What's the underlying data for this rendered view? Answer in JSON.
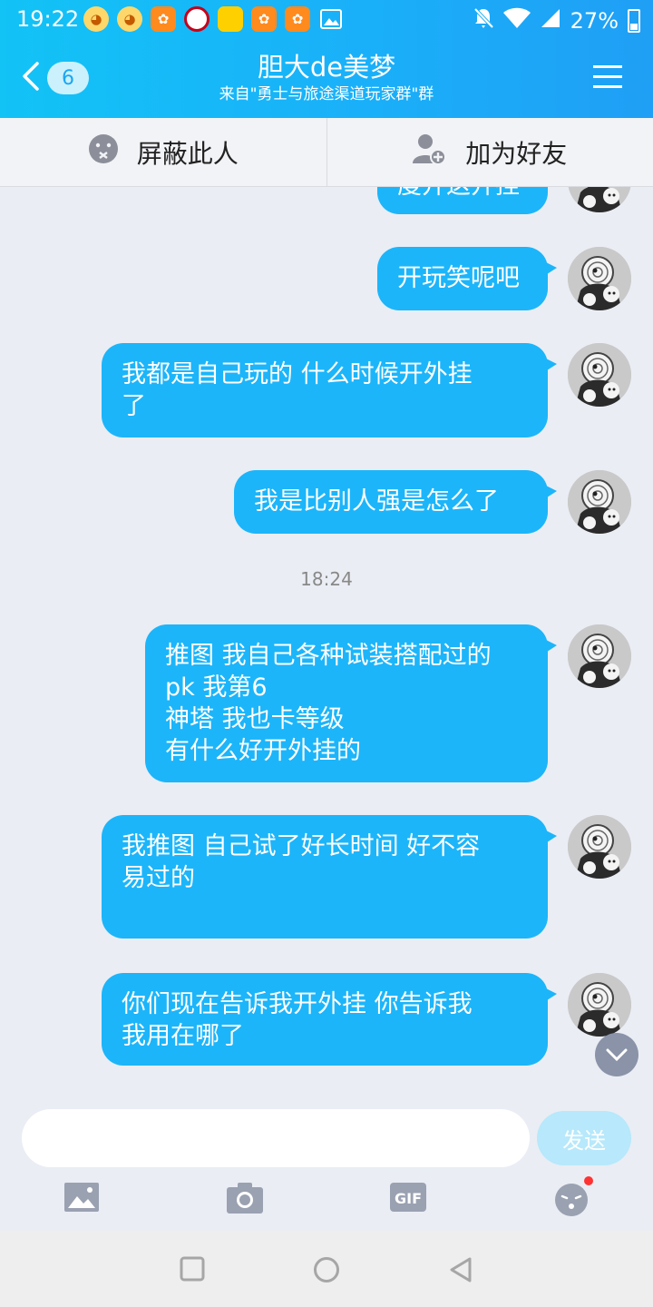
{
  "status_bar": {
    "time": "19:22",
    "battery": "27%"
  },
  "header": {
    "unread_count": "6",
    "title": "胆大de美梦",
    "subtitle": "来自\"勇士与旅途渠道玩家群\"群"
  },
  "actions": {
    "block": "屏蔽此人",
    "add_friend": "加为好友"
  },
  "messages": [
    {
      "text": "度开这开挂"
    },
    {
      "text": "开玩笑呢吧"
    },
    {
      "text": "我都是自己玩的 什么时候开外挂\n了"
    },
    {
      "text": "我是比别人强是怎么了"
    },
    {
      "text": "推图 我自己各种试装搭配过的\npk 我第6\n神塔 我也卡等级\n有什么好开外挂的"
    },
    {
      "text": "我推图 自己试了好长时间 好不容\n易过的"
    },
    {
      "text": "你们现在告诉我开外挂 你告诉我\n我用在哪了"
    }
  ],
  "time_separator": "18:24",
  "input": {
    "value": "",
    "placeholder": "",
    "send_label": "发送"
  },
  "toolbar": {
    "gif_label": "GIF"
  },
  "colors": {
    "bubble": "#1cb5fa",
    "header": "#1ab0f9",
    "send_disabled": "#b7e8fb"
  }
}
